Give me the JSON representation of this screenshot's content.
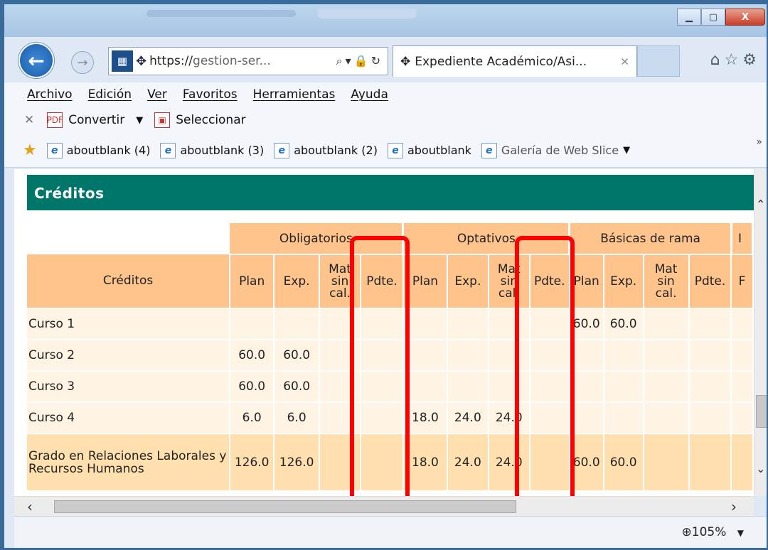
{
  "browser": {
    "address_prefix": "https://",
    "address_rest": "gestion-ser...",
    "tab_title": "Expediente Académico/Asi...",
    "zoom": "105%"
  },
  "menu": [
    "Archivo",
    "Edición",
    "Ver",
    "Favoritos",
    "Herramientas",
    "Ayuda"
  ],
  "toolbar": {
    "convert": "Convertir",
    "select": "Seleccionar"
  },
  "favorites": [
    "aboutblank (4)",
    "aboutblank (3)",
    "aboutblank (2)",
    "aboutblank",
    "Galería de Web Slice"
  ],
  "section": {
    "title": "Créditos"
  },
  "table": {
    "groups": [
      "Obligatorios",
      "Optativos",
      "Básicas de rama"
    ],
    "row_header": "Créditos",
    "cols": [
      "Plan",
      "Exp.",
      "Mat sin cal.",
      "Pdte."
    ],
    "rows": [
      {
        "label": "Curso 1",
        "vals": [
          "",
          "",
          "",
          "",
          "",
          "",
          "",
          "",
          "60.0",
          "60.0",
          "",
          ""
        ]
      },
      {
        "label": "Curso 2",
        "vals": [
          "60.0",
          "60.0",
          "",
          "",
          "",
          "",
          "",
          "",
          "",
          "",
          "",
          ""
        ]
      },
      {
        "label": "Curso 3",
        "vals": [
          "60.0",
          "60.0",
          "",
          "",
          "",
          "",
          "",
          "",
          "",
          "",
          "",
          ""
        ]
      },
      {
        "label": "Curso 4",
        "vals": [
          "6.0",
          "6.0",
          "",
          "",
          "18.0",
          "24.0",
          "24.0",
          "",
          "",
          "",
          "",
          ""
        ]
      },
      {
        "label": "Grado en Relaciones Laborales y Recursos Humanos",
        "vals": [
          "126.0",
          "126.0",
          "",
          "",
          "18.0",
          "24.0",
          "24.0",
          "",
          "60.0",
          "60.0",
          "",
          ""
        ]
      }
    ]
  }
}
